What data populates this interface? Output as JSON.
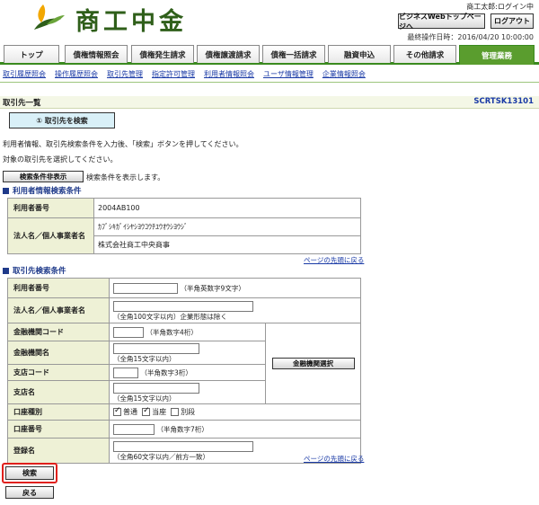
{
  "header": {
    "bank_name": "商工中金",
    "user_label": "商工太郎:ログイン中",
    "business_top_btn": "ビジネスWebトップページへ",
    "logout_btn": "ログアウト",
    "last_op": "最終操作日時：2016/04/20 10:00:00",
    "brand_color": "#2f5f1a"
  },
  "tabs": [
    "トップ",
    "債権情報照会",
    "債権発生請求",
    "債権譲渡請求",
    "債権一括請求",
    "融資申込",
    "その他請求",
    "管理業務"
  ],
  "subnav": [
    "取引履歴照会",
    "操作履歴照会",
    "取引先管理",
    "指定許可管理",
    "利用者情報照会",
    "ユーザ情報管理",
    "企業情報照会"
  ],
  "page": {
    "title": "取引先一覧",
    "screen_id": "SCRTSK13101",
    "step_label": "① 取引先を検索",
    "instruction1": "利用者情報、取引先検索条件を入力後、「検索」ボタンを押してください。",
    "instruction2": "対象の取引先を選択してください。",
    "toggle_btn": "検索条件非表示",
    "toggle_note": "検索条件を表示します。"
  },
  "user_info": {
    "section_title": "利用者情報検索条件",
    "rows": [
      {
        "label": "利用者番号",
        "value": "2004AB100"
      },
      {
        "label": "法人名／個人事業者名",
        "value_kana": "ｶﾌﾞｼｷｶﾞｲｼﾔｼﾖｳｺｳﾁﾕｳｵｳｼﾖｳｼﾞ",
        "value": "株式会社商工中央商事"
      }
    ],
    "top_link": "ページの先頭に戻る"
  },
  "search": {
    "section_title": "取引先検索条件",
    "user_no": {
      "label": "利用者番号",
      "hint": "（半角英数字9文字）"
    },
    "corp_name": {
      "label": "法人名／個人事業者名",
      "hint": "（全角100文字以内）企業形態は除く"
    },
    "bank_code": {
      "label": "金融機関コード",
      "hint": "（半角数字4桁）"
    },
    "bank_name": {
      "label": "金融機関名",
      "hint": "（全角15文字以内）"
    },
    "branch_code": {
      "label": "支店コード",
      "hint": "（半角数字3桁）"
    },
    "branch_name": {
      "label": "支店名",
      "hint": "（全角15文字以内）"
    },
    "bank_select_btn": "金融機関選択",
    "account_type": {
      "label": "口座種別",
      "options": [
        "普通",
        "当座",
        "別段"
      ],
      "checked": [
        true,
        true,
        false
      ]
    },
    "account_no": {
      "label": "口座番号",
      "hint": "（半角数字7桁）"
    },
    "registered_name": {
      "label": "登録名",
      "hint": "（全角60文字以内／前方一致）"
    },
    "top_link": "ページの先頭に戻る"
  },
  "actions": {
    "search_btn": "検索",
    "back_btn": "戻る"
  }
}
